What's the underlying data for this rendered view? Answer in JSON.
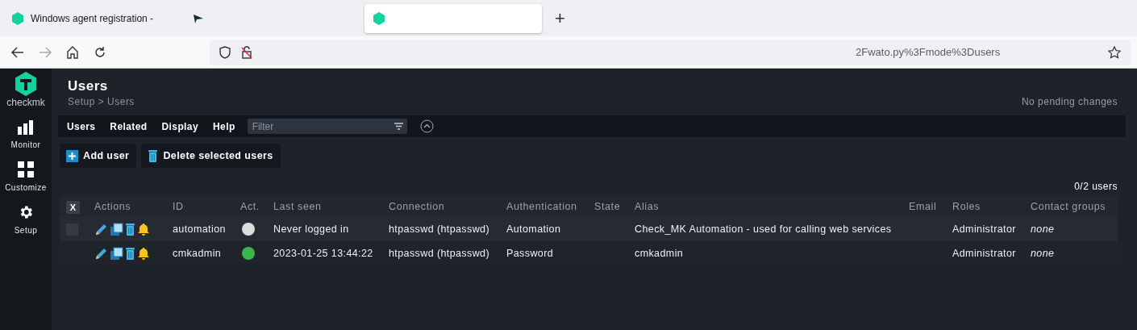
{
  "browser": {
    "tabs": [
      {
        "title": "Windows agent registration -",
        "selected": false,
        "kind": "checkmk"
      },
      {
        "selected": false,
        "kind": "bird"
      },
      {
        "selected": true,
        "kind": "checkmk"
      }
    ],
    "new_tab": "+",
    "url": "2Fwato.py%3Fmode%3Dusers"
  },
  "sidebar": {
    "logo_text": "checkmk",
    "items": [
      {
        "label": "Monitor",
        "kind": "monitor"
      },
      {
        "label": "Customize",
        "kind": "customize"
      },
      {
        "label": "Setup",
        "kind": "setup"
      }
    ]
  },
  "page": {
    "title": "Users",
    "breadcrumb": "Setup > Users",
    "pending": "No pending changes"
  },
  "menu": {
    "items": [
      "Users",
      "Related",
      "Display",
      "Help"
    ],
    "filter": {
      "placeholder": "Filter"
    }
  },
  "actions": [
    {
      "label": "Add user",
      "kind": "add"
    },
    {
      "label": "Delete selected users",
      "kind": "delete"
    }
  ],
  "table": {
    "count": "0/2 users",
    "select_all": "X",
    "columns": [
      "Actions",
      "ID",
      "Act.",
      "Last seen",
      "Connection",
      "Authentication",
      "State",
      "Alias",
      "Email",
      "Roles",
      "Contact groups"
    ],
    "rows": [
      {
        "checked": false,
        "id": "automation",
        "active": false,
        "last_seen": "Never logged in",
        "connection": "htpasswd (htpasswd)",
        "authentication": "Automation",
        "alias": "Check_MK Automation - used for calling web services",
        "roles": "Administrator",
        "contact_groups": "none"
      },
      {
        "id": "cmkadmin",
        "active": true,
        "last_seen": "2023-01-25 13:44:22",
        "connection": "htpasswd (htpasswd)",
        "authentication": "Password",
        "alias": "cmkadmin",
        "roles": "Administrator",
        "contact_groups": "none"
      }
    ]
  }
}
